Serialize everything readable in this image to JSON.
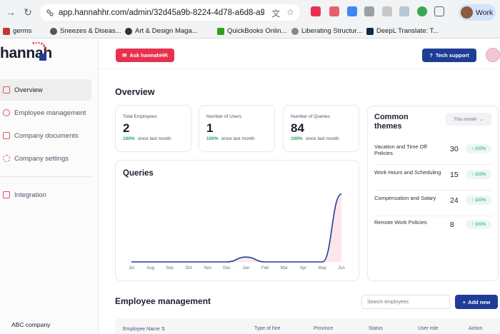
{
  "browser": {
    "url": "app.hannahhr.com/admin/32d45a9b-8224-4d78-a6d8-a974b...",
    "profile_label": "Work",
    "bookmarks": [
      "germs",
      "Sneezes & Diseas...",
      "Art & Design Maga...",
      "QuickBooks Onlin...",
      "Liberating Structur...",
      "DeepL Translate: T..."
    ]
  },
  "sidebar": {
    "logo": "hannah",
    "items": [
      {
        "label": "Overview"
      },
      {
        "label": "Employee management"
      },
      {
        "label": "Company documents"
      },
      {
        "label": "Company settings"
      },
      {
        "label": "Integration"
      }
    ],
    "company_name": "ABC company"
  },
  "header": {
    "ask_label": "Ask hannahHR",
    "tech_label": "Tech support"
  },
  "overview": {
    "title": "Overview",
    "stats": [
      {
        "label": "Total Employees",
        "value": "2",
        "change_pct": "100%",
        "change_text": "since last month"
      },
      {
        "label": "Number of Users",
        "value": "1",
        "change_pct": "100%",
        "change_text": "since last month"
      },
      {
        "label": "Number of Queries",
        "value": "84",
        "change_pct": "100%",
        "change_text": "since last month"
      }
    ]
  },
  "queries": {
    "title": "Queries"
  },
  "chart_data": {
    "type": "line",
    "title": "Queries",
    "categories": [
      "Jul",
      "Aug",
      "Sep",
      "Oct",
      "Nov",
      "Dec",
      "Jan",
      "Feb",
      "Mar",
      "Apr",
      "May",
      "Jun"
    ],
    "values": [
      0,
      0,
      0,
      0,
      0,
      0,
      6,
      0,
      0,
      0,
      0,
      84
    ],
    "ylim": [
      0,
      90
    ],
    "grid": false,
    "color": "#1f3d96",
    "fill": "#e7314e"
  },
  "themes": {
    "title": "Common themes",
    "period": "This month",
    "rows": [
      {
        "name": "Vacation and Time Off Policies",
        "count": "30",
        "badge": "100%"
      },
      {
        "name": "Work Hours and Scheduling",
        "count": "15",
        "badge": "100%"
      },
      {
        "name": "Compensation and Salary",
        "count": "24",
        "badge": "100%"
      },
      {
        "name": "Remote Work Policies",
        "count": "8",
        "badge": "100%"
      }
    ]
  },
  "employees": {
    "title": "Employee management",
    "search_placeholder": "Search employees",
    "add_label": "Add new",
    "columns": [
      "Employee Name",
      "Type of hire",
      "Province",
      "Status",
      "User role",
      "Action"
    ]
  }
}
